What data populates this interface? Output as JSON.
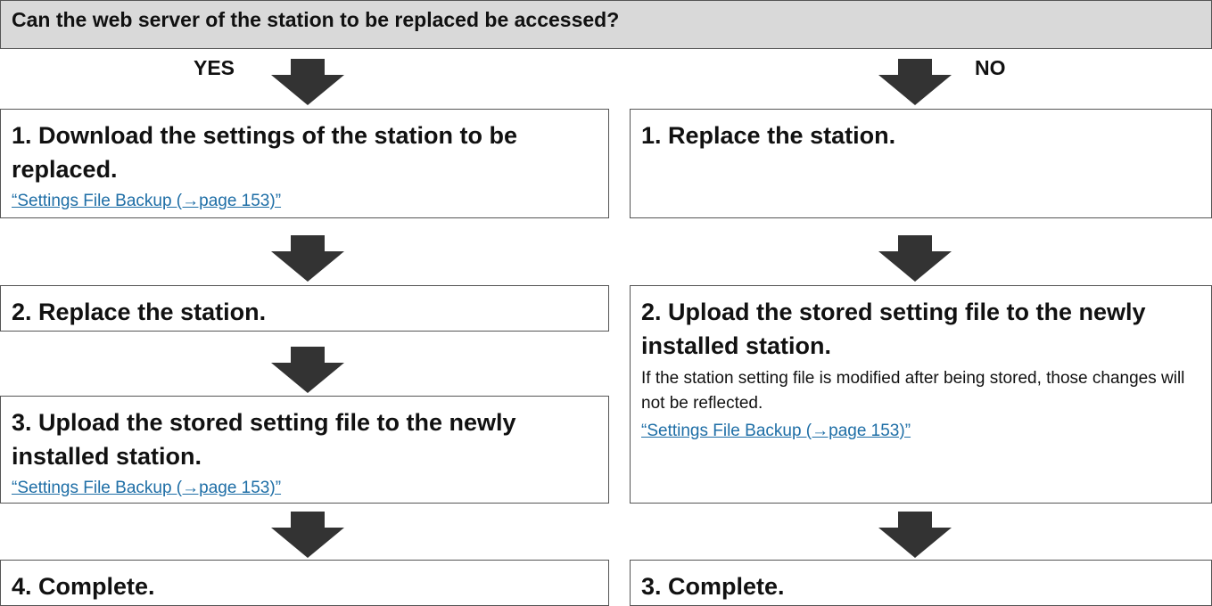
{
  "header": {
    "question": "Can the web server of the station to be replaced be accessed?"
  },
  "branches": {
    "yes_label": "YES",
    "no_label": "NO"
  },
  "yes_steps": [
    {
      "title": "1. Download the settings of the station to be replaced.",
      "link": "“Settings File Backup (→page 153)”"
    },
    {
      "title": "2. Replace the station."
    },
    {
      "title": "3. Upload the stored setting file to the newly installed station.",
      "link": "“Settings File Backup (→page 153)”"
    },
    {
      "title": "4. Complete."
    }
  ],
  "no_steps": [
    {
      "title": "1. Replace the station."
    },
    {
      "title": "2. Upload the stored setting file to the newly installed station.",
      "note": "If the station setting file is modified after being stored, those changes will not be reflected.",
      "link": "“Settings File Backup (→page 153)”"
    },
    {
      "title": "3. Complete."
    }
  ],
  "colors": {
    "arrow": "#333333",
    "header_bg": "#d9d9d9",
    "link": "#1e6ea6",
    "border": "#555555"
  }
}
